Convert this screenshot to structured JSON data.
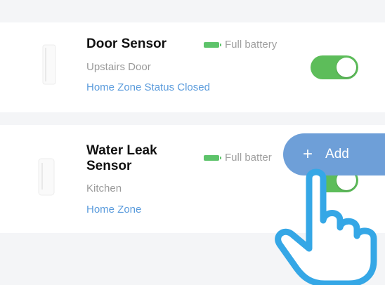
{
  "devices": [
    {
      "title": "Door Sensor",
      "location": "Upstairs Door",
      "zone": "Home Zone",
      "status": "Status Closed",
      "battery": "Full battery",
      "toggle_on": true
    },
    {
      "title_line1": "Water Leak",
      "title_line2": "Sensor",
      "location": "Kitchen",
      "zone": "Home Zone",
      "battery": "Full batter",
      "toggle_on": true
    }
  ],
  "add_button": {
    "icon": "+",
    "label": "Add"
  },
  "colors": {
    "toggle_on": "#5dbd5a",
    "battery": "#5dc36a",
    "zone_link": "#5a9bdc",
    "add_button": "#6e9fd8",
    "hand_outline": "#35a7e6",
    "background_band": "#f4f5f7"
  },
  "icons": {
    "device_image": "sensor-device-icon",
    "battery": "battery-full-icon",
    "pointer": "hand-pointer-icon"
  }
}
